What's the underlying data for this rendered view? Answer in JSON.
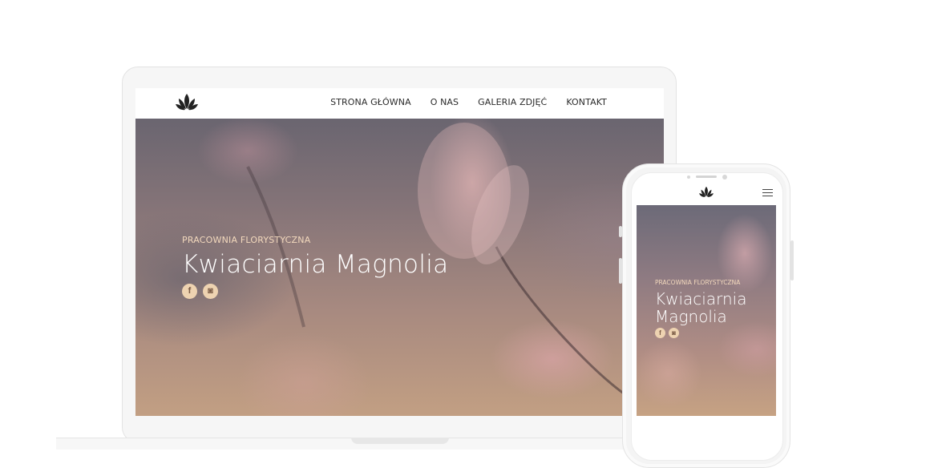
{
  "desktop": {
    "nav": [
      {
        "label": "STRONA GŁÓWNA"
      },
      {
        "label": "O NAS"
      },
      {
        "label": "GALERIA ZDJĘĆ"
      },
      {
        "label": "KONTAKT"
      }
    ],
    "hero": {
      "kicker": "PRACOWNIA FLORYSTYCZNA",
      "title": "Kwiaciarnia Magnolia",
      "social": [
        {
          "icon": "facebook-icon",
          "glyph": "f"
        },
        {
          "icon": "instagram-icon",
          "glyph": "◙"
        }
      ]
    }
  },
  "mobile": {
    "hero": {
      "kicker": "PRACOWNIA FLORYSTYCZNA",
      "title_line1": "Kwiaciarnia",
      "title_line2": "Magnolia",
      "social": [
        {
          "icon": "facebook-icon",
          "glyph": "f"
        },
        {
          "icon": "instagram-icon",
          "glyph": "◙"
        }
      ]
    },
    "menu_icon": "hamburger-menu-icon"
  },
  "colors": {
    "accent": "#eed3b1",
    "kicker": "#f3d9bd",
    "nav_text": "#2b2b2b"
  }
}
